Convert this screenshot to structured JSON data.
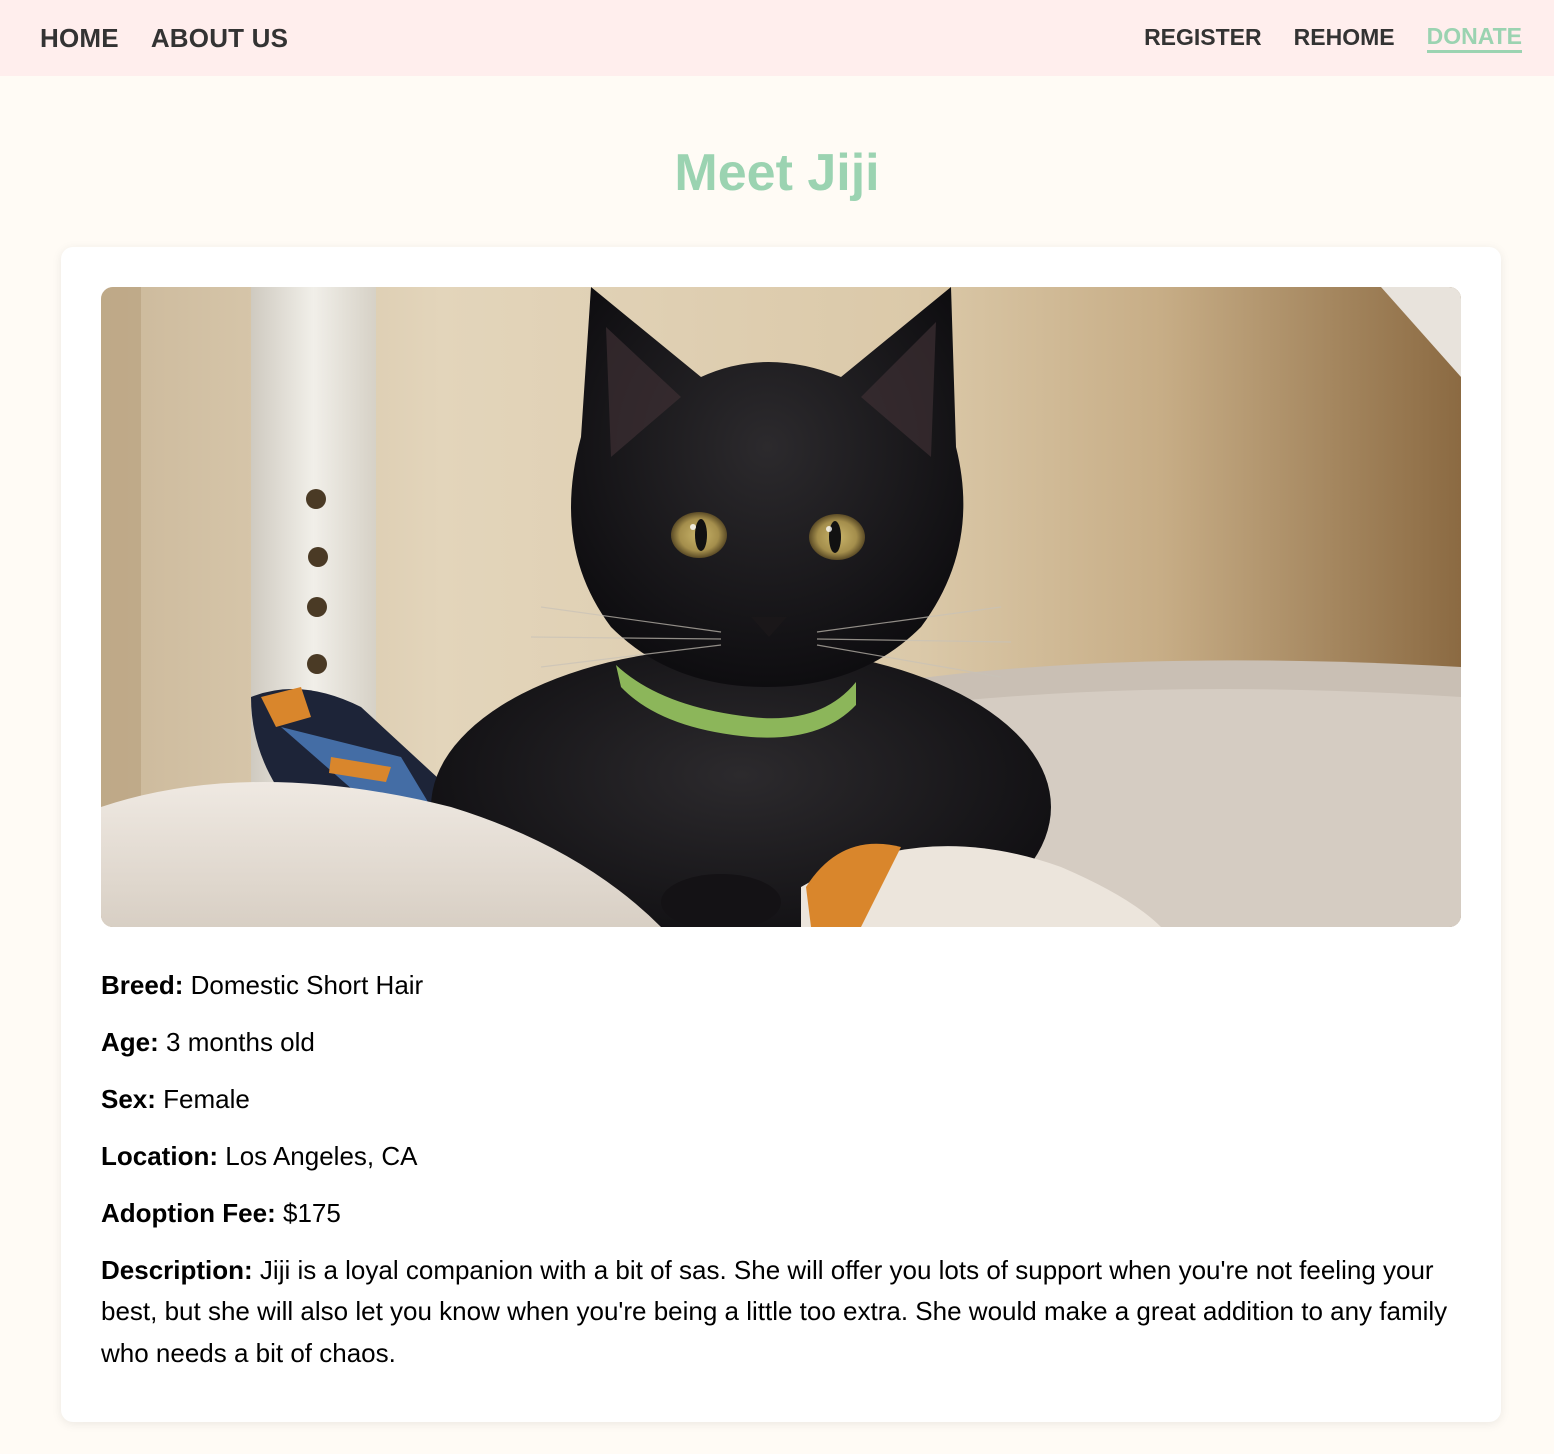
{
  "nav": {
    "left": [
      {
        "label": "HOME"
      },
      {
        "label": "ABOUT US"
      }
    ],
    "right": [
      {
        "label": "REGISTER"
      },
      {
        "label": "REHOME"
      },
      {
        "label": "DONATE"
      }
    ]
  },
  "page": {
    "title": "Meet Jiji"
  },
  "pet": {
    "breed_label": "Breed:",
    "breed": "Domestic Short Hair",
    "age_label": "Age:",
    "age": "3 months old",
    "sex_label": "Sex:",
    "sex": "Female",
    "location_label": "Location:",
    "location": "Los Angeles, CA",
    "fee_label": "Adoption Fee:",
    "fee": "$175",
    "description_label": "Description:",
    "description": "Jiji is a loyal companion with a bit of sas. She will offer you lots of support when you're not feeling your best, but she will also let you know when you're being a little too extra. She would make a great addition to any family who needs a bit of chaos."
  },
  "colors": {
    "accent": "#9bd3b1",
    "nav_background": "#ffeeed",
    "page_background": "#fffbf5"
  }
}
